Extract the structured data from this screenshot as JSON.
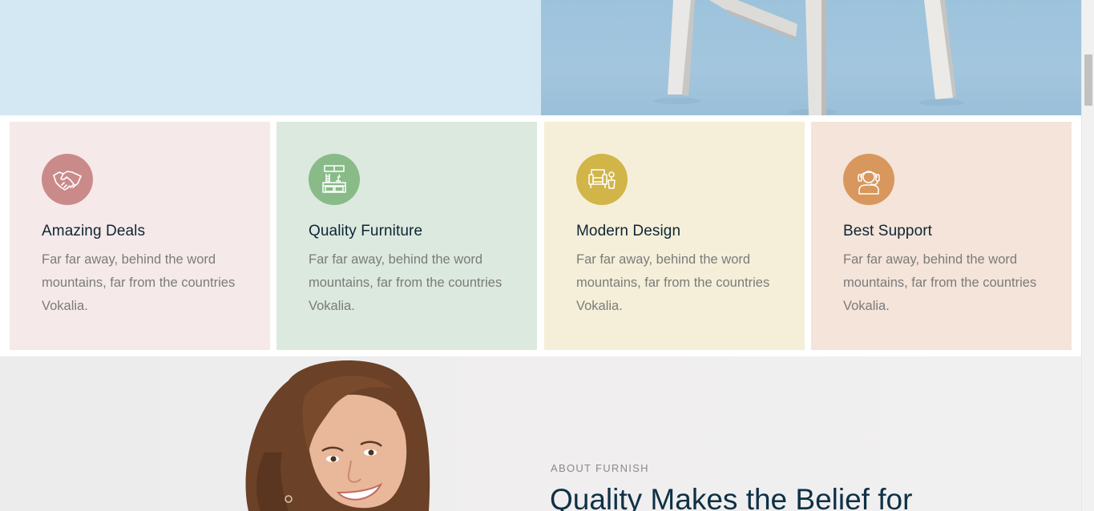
{
  "colors": {
    "hero_left": "#d4e8f3",
    "hero_right": "#9dc3dc",
    "card_backgrounds": [
      "#f5eae9",
      "#dce9de",
      "#f5efd9",
      "#f4e4d9"
    ],
    "icon_circles": [
      "#cb8a8a",
      "#88bb88",
      "#d1b548",
      "#d8975c"
    ],
    "heading": "#0e2535",
    "body_text": "#7b7b7b"
  },
  "features": [
    {
      "icon": "handshake-icon",
      "title": "Amazing Deals",
      "text": "Far far away, behind the word mountains, far from the countries Vokalia."
    },
    {
      "icon": "furniture-icon",
      "title": "Quality Furniture",
      "text": "Far far away, behind the word mountains, far from the countries Vokalia."
    },
    {
      "icon": "armchair-icon",
      "title": "Modern Design",
      "text": "Far far away, behind the word mountains, far from the countries Vokalia."
    },
    {
      "icon": "headset-icon",
      "title": "Best Support",
      "text": "Far far away, behind the word mountains, far from the countries Vokalia."
    }
  ],
  "about": {
    "kicker": "ABOUT FURNISH",
    "headline": "Quality Makes the Belief for"
  }
}
